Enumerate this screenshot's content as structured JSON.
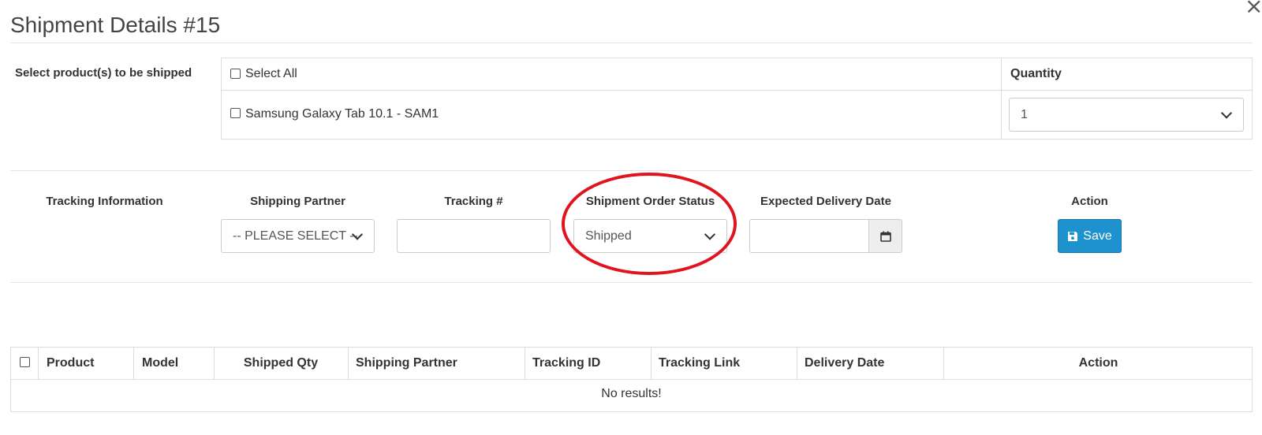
{
  "modal": {
    "title": "Shipment Details #15",
    "close_icon": "close-icon"
  },
  "products": {
    "section_label": "Select product(s) to be shipped",
    "select_all_label": "Select All",
    "quantity_header": "Quantity",
    "items": [
      {
        "label": "Samsung Galaxy Tab 10.1 - SAM1",
        "quantity": "1"
      }
    ]
  },
  "tracking": {
    "section_label": "Tracking Information",
    "shipping_partner_header": "Shipping Partner",
    "shipping_partner_value": "-- PLEASE SELECT --",
    "tracking_number_header": "Tracking #",
    "tracking_number_value": "",
    "status_header": "Shipment Order Status",
    "status_value": "Shipped",
    "delivery_date_header": "Expected Delivery Date",
    "delivery_date_value": "",
    "action_header": "Action",
    "save_label": "Save",
    "save_color": "#1e91cf",
    "annotation_color": "#e0141e"
  },
  "results_table": {
    "columns": [
      "Product",
      "Model",
      "Shipped Qty",
      "Shipping Partner",
      "Tracking ID",
      "Tracking Link",
      "Delivery Date",
      "Action"
    ],
    "empty_message": "No results!"
  }
}
